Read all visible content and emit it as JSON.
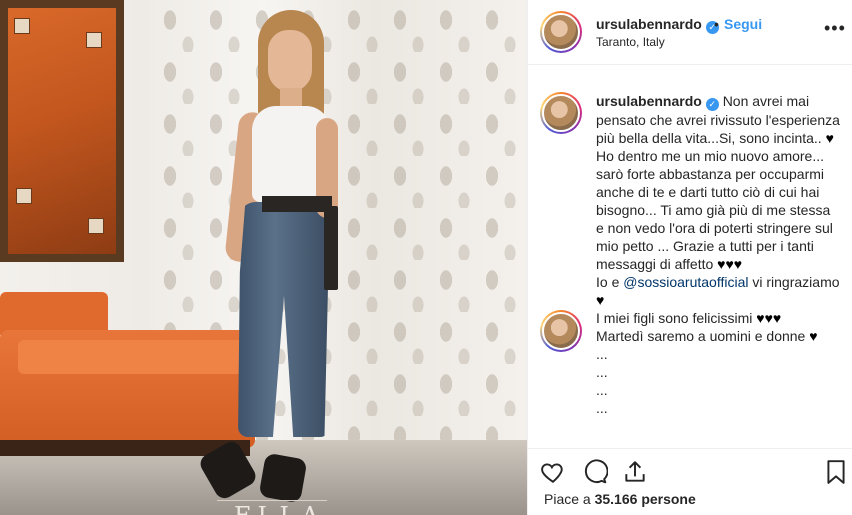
{
  "post": {
    "username": "ursulabennardo",
    "follow_label": "Segui",
    "separator": "•",
    "location": "Taranto, Italy",
    "more_icon": "more-options-icon",
    "verified_icon": "verified-badge-icon"
  },
  "caption": {
    "username": "ursulabennardo",
    "line1": "Non avrei mai pensato che avrei rivissuto l'esperienza più bella della vita...Si, sono incinta..",
    "line2": "Ho dentro me un mio nuovo amore... sarò forte abbastanza per occuparmi anche di te e darti tutto ciò di cui hai bisogno... Ti amo già più di me stessa e non vedo l'ora di poterti stringere sul mio petto ... Grazie a tutti per i tanti messaggi di affetto",
    "line3_prefix": "Io e",
    "mention": "@sossioarutaofficial",
    "line3_suffix": "vi ringraziamo",
    "line4": "I miei figli sono felicissimi",
    "line5": "Martedì saremo a uomini e donne",
    "dots": [
      "...",
      "...",
      "...",
      "..."
    ],
    "heart1": "♥",
    "hearts3": "♥♥♥"
  },
  "actions": {
    "like_icon": "heart-icon",
    "comment_icon": "comment-icon",
    "share_icon": "share-icon",
    "save_icon": "bookmark-icon"
  },
  "likes": {
    "prefix": "Piace a",
    "count": "35.166",
    "suffix": "persone"
  },
  "image": {
    "cover_text": "ELLA"
  },
  "colors": {
    "link": "#3897f0",
    "text": "#262626",
    "border": "#efefef"
  }
}
